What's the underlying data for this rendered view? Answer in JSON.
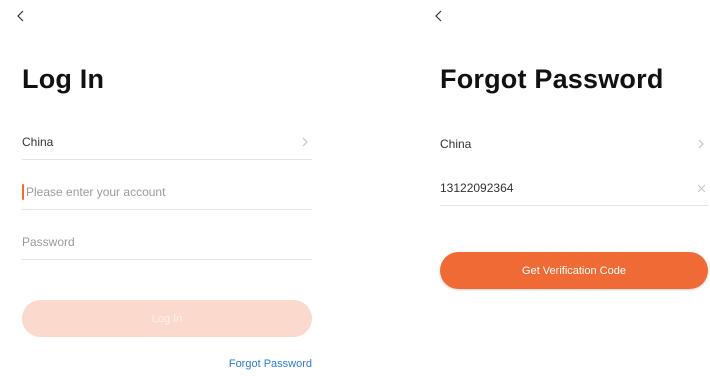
{
  "login": {
    "title": "Log In",
    "region": "China",
    "account_placeholder": "Please enter your account",
    "password_placeholder": "Password",
    "login_button": "Log In",
    "forgot_link": "Forgot Password"
  },
  "forgot": {
    "title": "Forgot Password",
    "region": "China",
    "phone_value": "13122092364",
    "verify_button": "Get Verification Code"
  },
  "colors": {
    "accent": "#f06a35",
    "accent_disabled": "#fbd9cd",
    "link": "#2b7bd6"
  },
  "icons": {
    "back": "back-arrow-icon",
    "region_arrow": "chevron-right-icon",
    "clear": "clear-x-icon"
  }
}
